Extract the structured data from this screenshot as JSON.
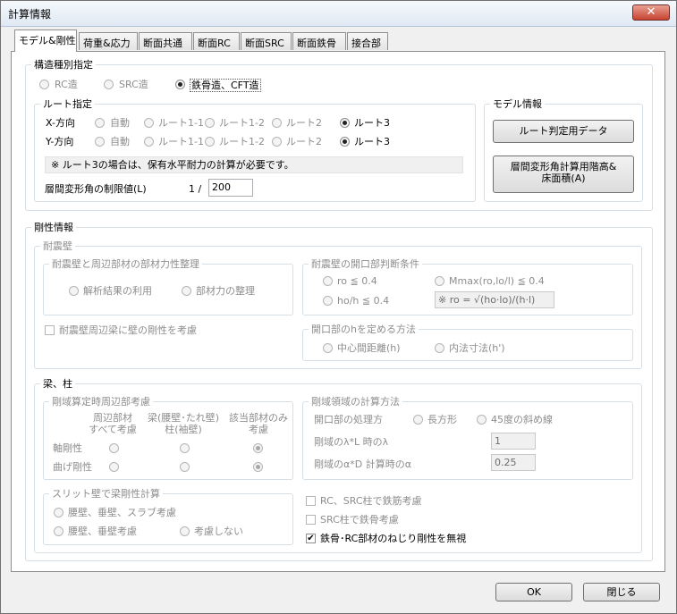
{
  "window": {
    "title": "計算情報",
    "close_symbol": "✕"
  },
  "tabs": [
    "モデル&剛性",
    "荷重&応力",
    "断面共通",
    "断面RC",
    "断面SRC",
    "断面鉄骨",
    "接合部"
  ],
  "structure": {
    "label": "構造種別指定",
    "options": [
      "RC造",
      "SRC造",
      "鉄骨造、CFT造"
    ],
    "selected": "鉄骨造、CFT造"
  },
  "route": {
    "label": "ルート指定",
    "x_label": "X-方向",
    "y_label": "Y-方向",
    "options": [
      "自動",
      "ルート1-1",
      "ルート1-2",
      "ルート2",
      "ルート3"
    ],
    "x_selected": "ルート3",
    "y_selected": "ルート3",
    "note": "※  ルート3の場合は、保有水平耐力の計算が必要です。",
    "drift_label": "層間変形角の制限値(L)",
    "drift_prefix": "1 /",
    "drift_value": "200"
  },
  "model_info": {
    "label": "モデル情報",
    "button1": "ルート判定用データ",
    "button2_line1": "層間変形角計算用階高&",
    "button2_line2": "床面積(A)"
  },
  "stiffness": {
    "label": "剛性情報",
    "wall": {
      "label": "耐震壁",
      "arrange": {
        "label": "耐震壁と周辺部材の部材力性整理",
        "options": [
          "解析結果の利用",
          "部材力の整理"
        ]
      },
      "opening": {
        "label": "耐震壁の開口部判断条件",
        "opt1": "ro ≦ 0.4",
        "opt2": "Mmax(ro,lo/l) ≦ 0.4",
        "opt3": "ho/h ≦ 0.4",
        "formula": "※ ro = √(ho·lo)/(h·l)"
      },
      "beam_check": "耐震壁周辺梁に壁の剛性を考慮",
      "hmethod": {
        "label": "開口部のhを定める方法",
        "options": [
          "中心間距離(h)",
          "内法寸法(h')"
        ]
      }
    },
    "beamcol": {
      "label": "梁、柱",
      "rigid_zone": {
        "label": "剛域算定時周辺部考慮",
        "col1_line1": "周辺部材",
        "col1_line2": "すべて考慮",
        "col2_line1": "梁(腰壁･たれ壁)",
        "col2_line2": "柱(袖壁)",
        "col3_line1": "該当部材のみ",
        "col3_line2": "考慮",
        "row1": "軸剛性",
        "row2": "曲げ剛性",
        "axial_selected": "該当部材のみ考慮",
        "bending_selected": "該当部材のみ考慮"
      },
      "rigid_calc": {
        "label": "剛域領域の計算方法",
        "opening_label": "開口部の処理方",
        "options": [
          "長方形",
          "45度の斜め線"
        ],
        "lambda_label": "剛域のλ*L 時のλ",
        "lambda_value": "1",
        "alpha_label": "剛域のα*D 計算時のα",
        "alpha_value": "0.25"
      },
      "slit": {
        "label": "スリット壁で梁剛性計算",
        "opt1": "腰壁、垂壁、スラブ考慮",
        "opt2": "腰壁、垂壁考慮",
        "opt3": "考慮しない"
      },
      "checks": [
        {
          "label": "RC、SRC柱で鉄筋考慮",
          "checked": false,
          "enabled": false
        },
        {
          "label": "SRC柱で鉄骨考慮",
          "checked": false,
          "enabled": false
        },
        {
          "label": "鉄骨･RC部材のねじり剛性を無視",
          "checked": true,
          "enabled": true
        }
      ]
    }
  },
  "footer": {
    "ok": "OK",
    "close": "閉じる"
  }
}
